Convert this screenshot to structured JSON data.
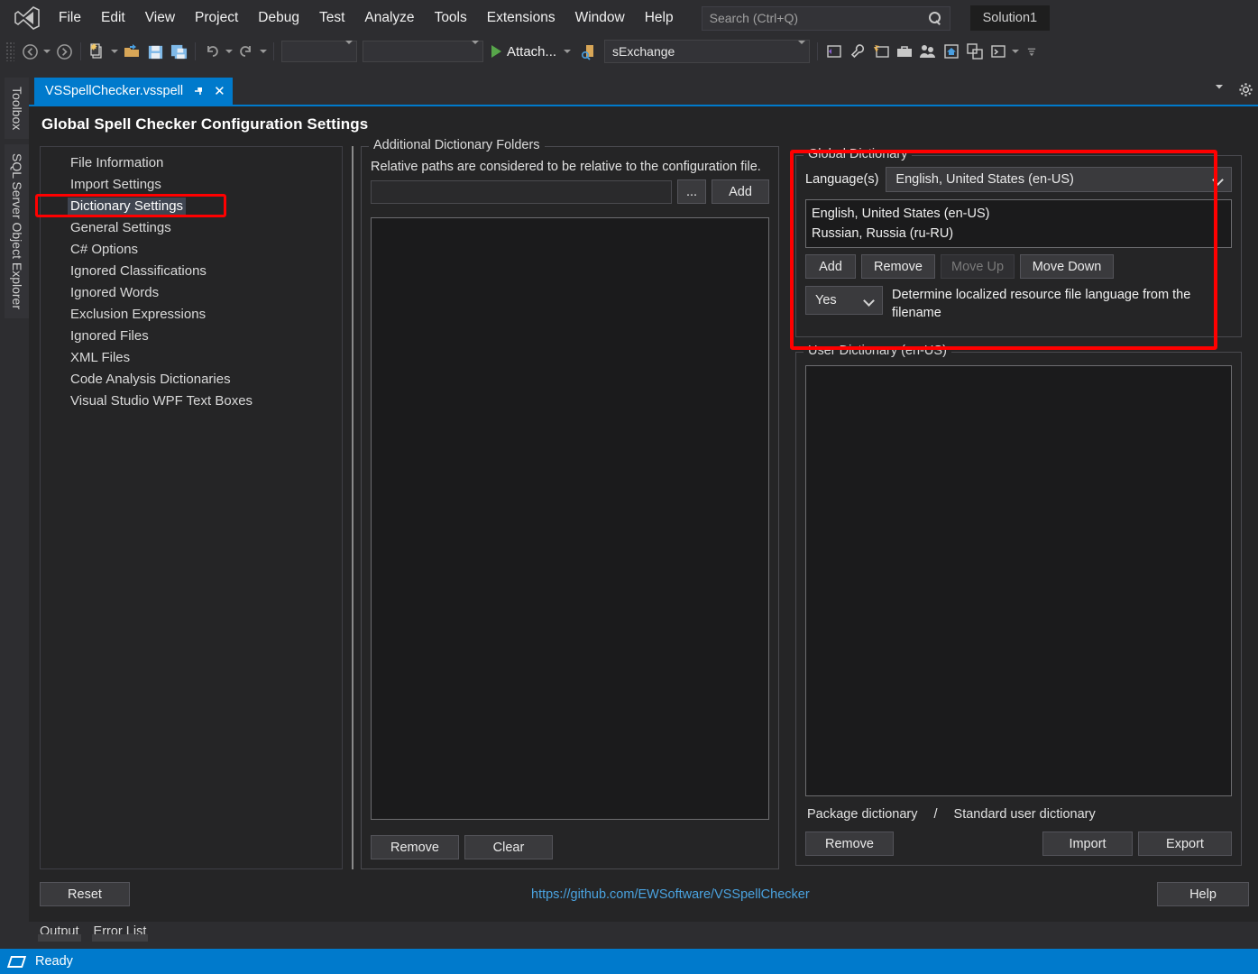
{
  "menu": {
    "logo_icon": "visual-studio-logo-icon",
    "items": [
      "File",
      "Edit",
      "View",
      "Project",
      "Debug",
      "Test",
      "Analyze",
      "Tools",
      "Extensions",
      "Window",
      "Help"
    ],
    "search_placeholder": "Search (Ctrl+Q)",
    "search_icon": "search-icon",
    "solution_chip": "Solution1"
  },
  "toolbar": {
    "back_icon": "navigate-back-icon",
    "forward_icon": "navigate-forward-icon",
    "new_item_icon": "new-item-icon",
    "open_icon": "open-file-icon",
    "save_icon": "save-icon",
    "save_all_icon": "save-all-icon",
    "undo_icon": "undo-icon",
    "redo_icon": "redo-icon",
    "combo1_value": "",
    "combo2_value": "",
    "attach_label": "Attach...",
    "attach_icon": "start-debug-icon",
    "process_icon": "process-icon",
    "process_value": "sExchange",
    "right_icons": [
      "vs-window-icon",
      "wrench-icon",
      "vs-feedback-icon",
      "toolbox-icon",
      "team-explorer-icon",
      "home-icon",
      "clone-repo-icon",
      "terminal-icon"
    ],
    "overflow_icon": "toolbar-overflow-icon"
  },
  "leftdock": {
    "tabs": [
      "Toolbox",
      "SQL Server Object Explorer"
    ]
  },
  "tab": {
    "title": "VSSpellChecker.vsspell",
    "pin_icon": "pin-icon",
    "close_icon": "close-icon",
    "chevron_icon": "chevron-down-icon",
    "gear_icon": "gear-icon"
  },
  "page": {
    "title": "Global Spell Checker Configuration Settings",
    "nav_items": [
      "File Information",
      "Import Settings",
      "Dictionary Settings",
      "General Settings",
      "C# Options",
      "Ignored Classifications",
      "Ignored Words",
      "Exclusion Expressions",
      "Ignored Files",
      "XML Files",
      "Code Analysis Dictionaries",
      "Visual Studio WPF Text Boxes"
    ],
    "nav_selected_index": 2,
    "reset_label": "Reset",
    "link": "https://github.com/EWSoftware/VSSpellChecker",
    "help_label": "Help"
  },
  "middle": {
    "legend": "Additional Dictionary Folders",
    "hint": "Relative paths are considered to be relative to the configuration file.",
    "path_value": "",
    "browse_label": "...",
    "add_label": "Add",
    "folders": [],
    "remove_label": "Remove",
    "clear_label": "Clear"
  },
  "global_dictionary": {
    "legend": "Global Dictionary",
    "language_label": "Language(s)",
    "language_selected": "English, United States (en-US)",
    "selected_languages": [
      "English, United States (en-US)",
      "Russian, Russia (ru-RU)"
    ],
    "add_label": "Add",
    "remove_label": "Remove",
    "move_up_label": "Move Up",
    "move_up_disabled": true,
    "move_down_label": "Move Down",
    "determine_value": "Yes",
    "determine_label": "Determine localized resource file language from the filename",
    "highlight_color": "#ff0000"
  },
  "user_dictionary": {
    "legend": "User Dictionary (en-US)",
    "words": [],
    "package_label": "Package dictionary",
    "separator": "/",
    "standard_label": "Standard user dictionary",
    "remove_label": "Remove",
    "import_label": "Import",
    "export_label": "Export"
  },
  "bottom_tabs": [
    "Output",
    "Error List"
  ],
  "statusbar": {
    "icon": "ready-flag-icon",
    "text": "Ready"
  },
  "colors": {
    "accent": "#007acc",
    "window_bg": "#2d2d30",
    "editor_bg": "#252526",
    "annotation": "#ff0000",
    "link": "#4aa3e0"
  }
}
